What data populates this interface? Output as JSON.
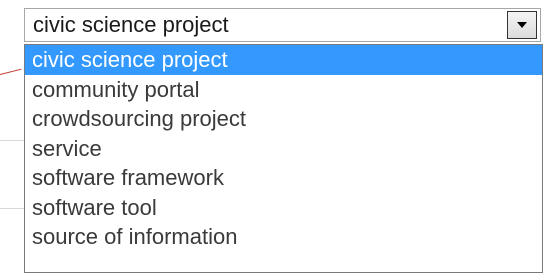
{
  "select": {
    "current_value": "civic science project",
    "arrow_icon": "chevron-down-icon"
  },
  "dropdown": {
    "selected_index": 0,
    "options": [
      "civic science project",
      "community portal",
      "crowdsourcing project",
      "service",
      "software framework",
      "software tool",
      "source of information"
    ]
  },
  "colors": {
    "highlight": "#3399ff",
    "highlight_text": "#ffffff",
    "option_text": "#3a3a3a",
    "border": "#7a7a7a"
  }
}
